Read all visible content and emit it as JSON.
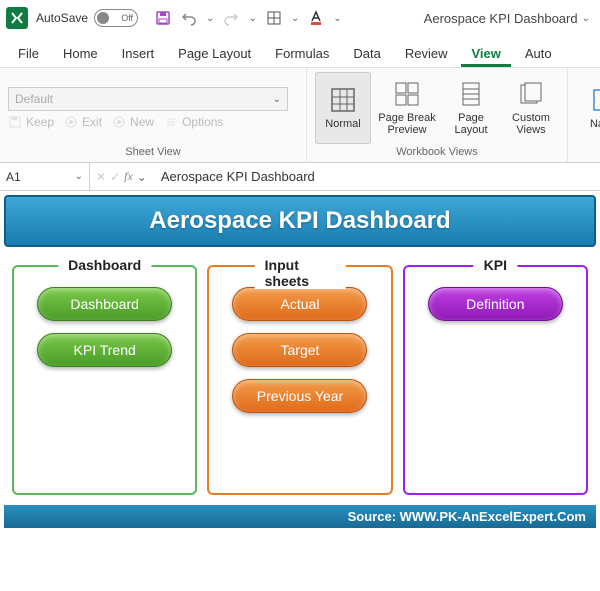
{
  "titlebar": {
    "autosave_label": "AutoSave",
    "autosave_state": "Off",
    "doc_title": "Aerospace KPI Dashboard"
  },
  "tabs": {
    "file": "File",
    "home": "Home",
    "insert": "Insert",
    "page_layout": "Page Layout",
    "formulas": "Formulas",
    "data": "Data",
    "review": "Review",
    "view": "View",
    "auto": "Auto"
  },
  "ribbon": {
    "sheet_view": {
      "default": "Default",
      "keep": "Keep",
      "exit": "Exit",
      "new": "New",
      "options": "Options",
      "label": "Sheet View"
    },
    "workbook_views": {
      "normal": "Normal",
      "page_break": "Page Break Preview",
      "page_layout": "Page Layout",
      "custom": "Custom Views",
      "navig": "Navig",
      "label": "Workbook Views"
    }
  },
  "formula_bar": {
    "cell": "A1",
    "value": "Aerospace KPI Dashboard"
  },
  "sheet": {
    "banner": "Aerospace KPI Dashboard",
    "panels": {
      "dashboard": {
        "title": "Dashboard",
        "btn1": "Dashboard",
        "btn2": "KPI Trend"
      },
      "input": {
        "title": "Input sheets",
        "btn1": "Actual",
        "btn2": "Target",
        "btn3": "Previous Year"
      },
      "kpi": {
        "title": "KPI",
        "btn1": "Definition"
      }
    },
    "footer": "Source: WWW.PK-AnExcelExpert.Com"
  }
}
